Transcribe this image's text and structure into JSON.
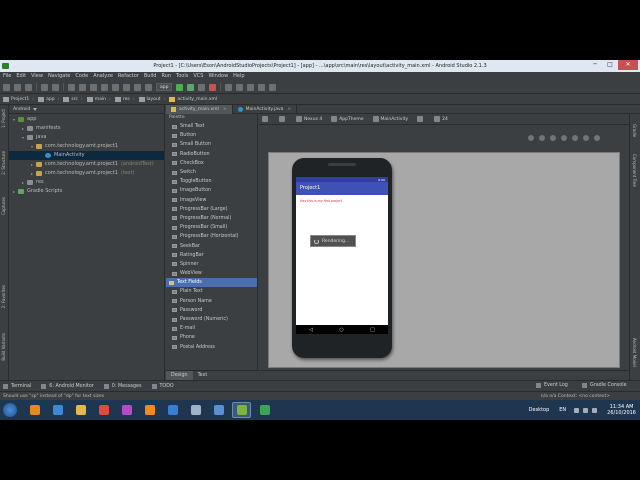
{
  "window": {
    "title": "Project1 - [C:\\Users\\Eson\\AndroidStudioProjects\\Project1] - [app] - ...\\app\\src\\main\\res\\layout\\activity_main.xml - Android Studio 2.1.3",
    "controls": [
      "─",
      "□",
      "✕"
    ]
  },
  "menu": [
    "File",
    "Edit",
    "View",
    "Navigate",
    "Code",
    "Analyze",
    "Refactor",
    "Build",
    "Run",
    "Tools",
    "VCS",
    "Window",
    "Help"
  ],
  "toolbar": {
    "run_config": "app"
  },
  "breadcrumbs": [
    "Project1",
    "app",
    "src",
    "main",
    "res",
    "layout",
    "activity_main.xml"
  ],
  "project_panel": {
    "view_mode": "Android",
    "tree": [
      {
        "label": "app",
        "indent": 0,
        "icon": "app",
        "twisty": "▾"
      },
      {
        "label": "manifests",
        "indent": 1,
        "icon": "folder",
        "twisty": "▸"
      },
      {
        "label": "java",
        "indent": 1,
        "icon": "folder",
        "twisty": "▾"
      },
      {
        "label": "com.technology.amt.project1",
        "indent": 2,
        "icon": "pkg",
        "twisty": "▾"
      },
      {
        "label": "MainActivity",
        "indent": 3,
        "icon": "cls",
        "twisty": "",
        "selected": true
      },
      {
        "label": "com.technology.amt.project1",
        "sub": "(androidTest)",
        "indent": 2,
        "icon": "pkg",
        "twisty": "▸"
      },
      {
        "label": "com.technology.amt.project1",
        "sub": "(test)",
        "indent": 2,
        "icon": "pkg",
        "twisty": "▸"
      },
      {
        "label": "res",
        "indent": 1,
        "icon": "folder",
        "twisty": "▸"
      },
      {
        "label": "Gradle Scripts",
        "indent": 0,
        "icon": "gr",
        "twisty": "▸"
      }
    ]
  },
  "left_tool_tabs": [
    "1: Project",
    "2: Structure",
    "Captures",
    "2: Favorites",
    "Build Variants"
  ],
  "editor_tabs": [
    {
      "label": "activity_main.xml",
      "active": true,
      "type": "xml"
    },
    {
      "label": "MainActivity.java",
      "active": false,
      "type": "java"
    }
  ],
  "palette": {
    "header": "Palette",
    "items": [
      {
        "label": "Small Text"
      },
      {
        "label": "Button"
      },
      {
        "label": "Small Button"
      },
      {
        "label": "RadioButton"
      },
      {
        "label": "CheckBox"
      },
      {
        "label": "Switch"
      },
      {
        "label": "ToggleButton"
      },
      {
        "label": "ImageButton"
      },
      {
        "label": "ImageView"
      },
      {
        "label": "ProgressBar (Large)"
      },
      {
        "label": "ProgressBar (Normal)"
      },
      {
        "label": "ProgressBar (Small)"
      },
      {
        "label": "ProgressBar (Horizontal)"
      },
      {
        "label": "SeekBar"
      },
      {
        "label": "RatingBar"
      },
      {
        "label": "Spinner"
      },
      {
        "label": "WebView"
      },
      {
        "label": "Text Fields",
        "group": true
      },
      {
        "label": "Plain Text"
      },
      {
        "label": "Person Name"
      },
      {
        "label": "Password"
      },
      {
        "label": "Password (Numeric)"
      },
      {
        "label": "E-mail"
      },
      {
        "label": "Phone"
      },
      {
        "label": "Postal Address"
      }
    ]
  },
  "design_toolbar": {
    "device": "Nexus 4",
    "theme": "AppTheme",
    "activity": "MainActivity",
    "api": "24"
  },
  "preview": {
    "app_title": "Project1",
    "status_time": "6:00",
    "hello_text": "Hey this is my first project",
    "rendering_text": "Rendering...",
    "nav_back": "◁",
    "nav_home": "○",
    "nav_recent": "□"
  },
  "right_tool_tabs": [
    "Gradle",
    "Component Tree",
    "Android Model"
  ],
  "view_tabs": [
    "Design",
    "Text"
  ],
  "bottom_tools": {
    "left": [
      "Terminal",
      "6: Android Monitor",
      "0: Messages",
      "TODO"
    ],
    "right": [
      "Event Log",
      "Gradle Console"
    ]
  },
  "status": {
    "message": "Should use \"sp\" instead of \"dp\" for text sizes",
    "right": "n/a    n/a    Context: <no context>"
  },
  "taskbar": {
    "desktop_label": "Desktop",
    "language": "EN",
    "time": "11:34 AM",
    "date": "26/10/2016",
    "apps": [
      {
        "name": "windows-media-player-icon",
        "color": "#e68a1e"
      },
      {
        "name": "ie-icon",
        "color": "#3c8ad6"
      },
      {
        "name": "explorer-icon",
        "color": "#e6b84a"
      },
      {
        "name": "chrome-icon",
        "color": "#e14b3b"
      },
      {
        "name": "firefox-icon",
        "color": "#b84ac9"
      },
      {
        "name": "settings-app-icon",
        "color": "#f28a1e"
      },
      {
        "name": "cortana-c-icon",
        "color": "#3a7dd6"
      },
      {
        "name": "document-icon",
        "color": "#9fb2c8"
      },
      {
        "name": "monitor-icon",
        "color": "#5a8fd1"
      },
      {
        "name": "android-studio-icon",
        "color": "#7cb342",
        "active": true
      },
      {
        "name": "c-green-icon",
        "color": "#3aa655"
      }
    ]
  }
}
